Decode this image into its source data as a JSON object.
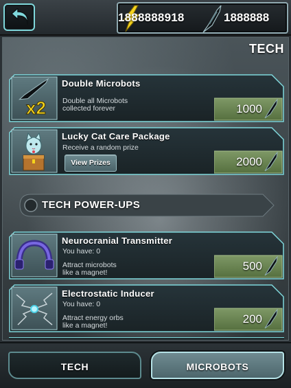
{
  "header": {
    "energy_count": "1888888918",
    "microbot_count": "1888888"
  },
  "main": {
    "section_title": "TECH",
    "items": [
      {
        "title": "Double Microbots",
        "description": [
          "Double all Microbots",
          "collected forever"
        ],
        "price": "1000",
        "icon_label": "x2"
      },
      {
        "title": "Lucky Cat Care Package",
        "description": [
          "Receive a random prize"
        ],
        "price": "2000",
        "button_label": "View Prizes"
      }
    ],
    "powerups_header": "TECH POWER-UPS",
    "powerups": [
      {
        "title": "Neurocranial Transmitter",
        "owned": "You have: 0",
        "description": [
          "Attract microbots",
          "like a magnet!"
        ],
        "price": "500"
      },
      {
        "title": "Electrostatic Inducer",
        "owned": "You have: 0",
        "description": [
          "Attract energy orbs",
          "like a magnet!"
        ],
        "price": "200"
      }
    ]
  },
  "tabs": {
    "tech_label": "TECH",
    "microbots_label": "MICROBOTS",
    "active": "MICROBOTS"
  },
  "colors": {
    "accent_teal": "#7fd8dc",
    "price_green": "#6b8557",
    "card_dark": "#1e2a2d",
    "energy_yellow": "#f5d31c"
  },
  "icons": {
    "back": "back-arrow-icon",
    "energy": "lightning-bolt-icon",
    "currency": "microbot-icon"
  }
}
